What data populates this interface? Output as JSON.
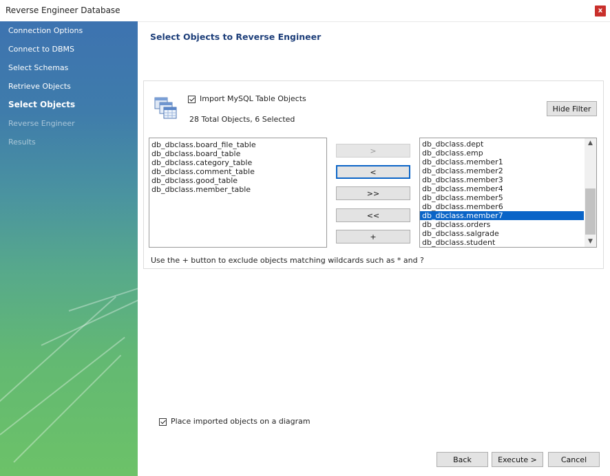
{
  "window": {
    "title": "Reverse Engineer Database",
    "close_label": "x"
  },
  "sidebar": {
    "items": [
      {
        "label": "Connection Options",
        "state": "done"
      },
      {
        "label": "Connect to DBMS",
        "state": "done"
      },
      {
        "label": "Select Schemas",
        "state": "done"
      },
      {
        "label": "Retrieve Objects",
        "state": "done"
      },
      {
        "label": "Select Objects",
        "state": "active"
      },
      {
        "label": "Reverse Engineer",
        "state": "disabled"
      },
      {
        "label": "Results",
        "state": "disabled"
      }
    ]
  },
  "main": {
    "heading": "Select Objects to Reverse Engineer",
    "import_label": "Import MySQL Table Objects",
    "import_checked": true,
    "summary": "28 Total Objects, 6 Selected",
    "hide_filter_label": "Hide Filter",
    "left_list": [
      "db_dbclass.board_file_table",
      "db_dbclass.board_table",
      "db_dbclass.category_table",
      "db_dbclass.comment_table",
      "db_dbclass.good_table",
      "db_dbclass.member_table"
    ],
    "right_list": [
      "db_dbclass.dept",
      "db_dbclass.emp",
      "db_dbclass.member1",
      "db_dbclass.member2",
      "db_dbclass.member3",
      "db_dbclass.member4",
      "db_dbclass.member5",
      "db_dbclass.member6",
      "db_dbclass.member7",
      "db_dbclass.orders",
      "db_dbclass.salgrade",
      "db_dbclass.student"
    ],
    "right_list_selected": "db_dbclass.member7",
    "buttons": {
      "move_right": ">",
      "move_left": "<",
      "move_all_right": ">>",
      "move_all_left": "<<",
      "add_wildcard": "+"
    },
    "hint": "Use the + button to exclude objects matching wildcards such as * and ?",
    "diagram_label": "Place imported objects on a diagram",
    "diagram_checked": true
  },
  "footer": {
    "back": "Back",
    "execute": "Execute >",
    "cancel": "Cancel"
  },
  "icons": {
    "close": "close-icon",
    "database": "database-tables-icon",
    "scroll_up": "scroll-up-icon",
    "scroll_down": "scroll-down-icon"
  }
}
